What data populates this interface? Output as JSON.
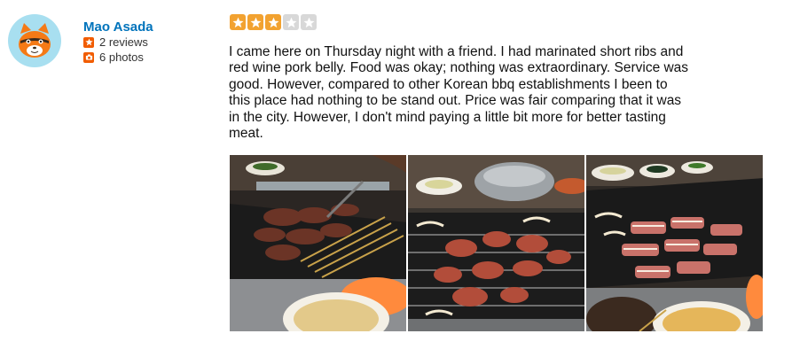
{
  "user": {
    "name": "Mao Asada",
    "reviews_text": "2 reviews",
    "photos_text": "6 photos",
    "avatar_icon": "cat-face-icon"
  },
  "review": {
    "rating": 3,
    "max_rating": 5,
    "star_color": "#f2a230",
    "star_empty_color": "#d8d8d8",
    "text": "I came here on Thursday night with a friend. I had marinated short ribs and red wine pork belly. Food was okay; nothing was extraordinary. Service was good. However, compared to other Korean bbq establishments I been to this place had nothing to be stand out. Price was fair comparing that it was in the city. However, I don't mind paying a little bit more for better tasting meat."
  },
  "photos": [
    {
      "icon": "bbq-grill-photo"
    },
    {
      "icon": "bbq-grill-photo"
    },
    {
      "icon": "bbq-grill-photo"
    }
  ],
  "colors": {
    "link": "#0073bb",
    "accent": "#f15c00",
    "avatar_bg": "#a8dff0"
  }
}
